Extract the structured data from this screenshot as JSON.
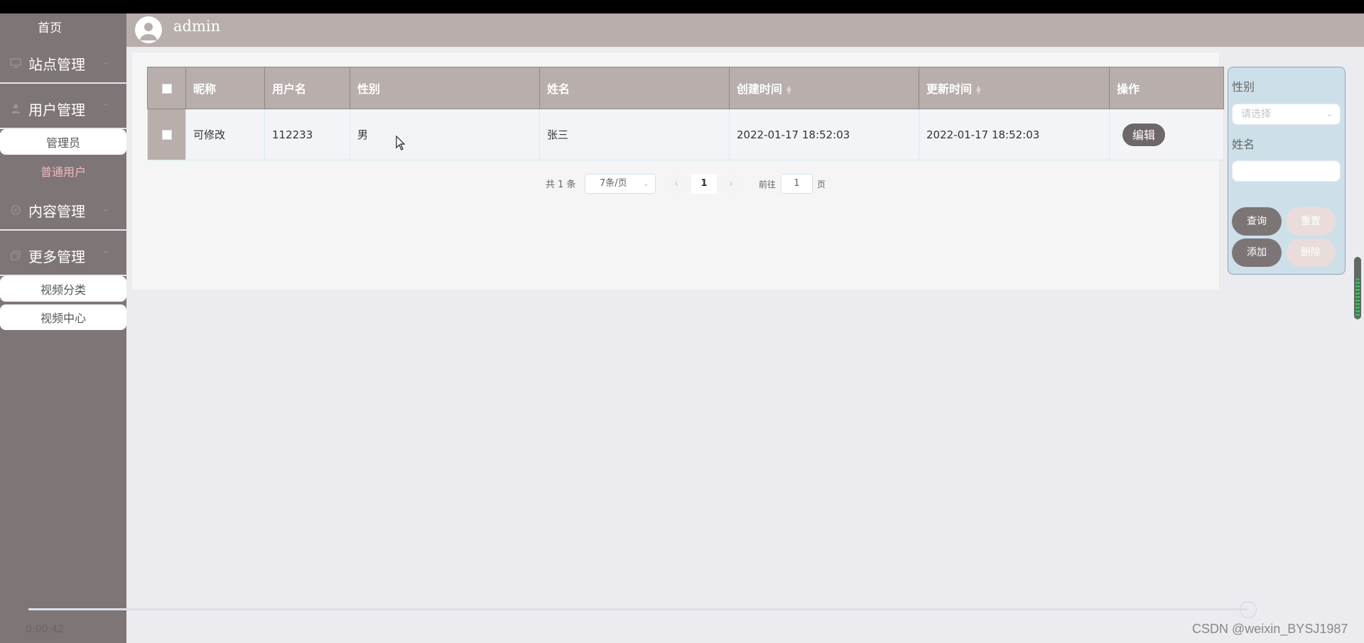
{
  "sidebar": {
    "home": "首页",
    "groups": [
      {
        "label": "站点管理",
        "icon": "monitor-icon",
        "expanded": false
      },
      {
        "label": "用户管理",
        "icon": "user-icon",
        "expanded": true,
        "children": [
          "管理员",
          "普通用户"
        ]
      },
      {
        "label": "内容管理",
        "icon": "message-icon",
        "expanded": false
      },
      {
        "label": "更多管理",
        "icon": "copy-icon",
        "expanded": true,
        "children": [
          "视频分类",
          "视频中心"
        ]
      }
    ],
    "active_child": "普通用户",
    "timestamp": "0:00:42"
  },
  "header": {
    "username": "admin",
    "avatar_icon": "user-avatar-icon"
  },
  "table": {
    "columns": [
      "昵称",
      "用户名",
      "性别",
      "姓名",
      "创建时间",
      "更新时间",
      "操作"
    ],
    "sortable": [
      "创建时间",
      "更新时间"
    ],
    "rows": [
      {
        "nickname": "可修改",
        "username": "112233",
        "gender": "男",
        "name": "张三",
        "created": "2022-01-17 18:52:03",
        "updated": "2022-01-17 18:52:03",
        "action": "编辑"
      }
    ]
  },
  "pagination": {
    "total_label": "共 1 条",
    "page_size": "7条/页",
    "current_page": "1",
    "goto_label": "前往",
    "goto_value": "1",
    "page_unit": "页"
  },
  "search": {
    "gender_label": "性别",
    "gender_placeholder": "请选择",
    "name_label": "姓名",
    "query_button": "查询",
    "reset_button": "重置",
    "add_button": "添加",
    "delete_button": "删除"
  },
  "watermark": "CSDN @weixin_BYSJ1987",
  "colors": {
    "sidebar_bg": "#7e7576",
    "header_bg": "#b8aeac",
    "accent_pink": "#f3b8c0",
    "search_bg": "#cde0ea",
    "button_dark": "#7c7576"
  }
}
